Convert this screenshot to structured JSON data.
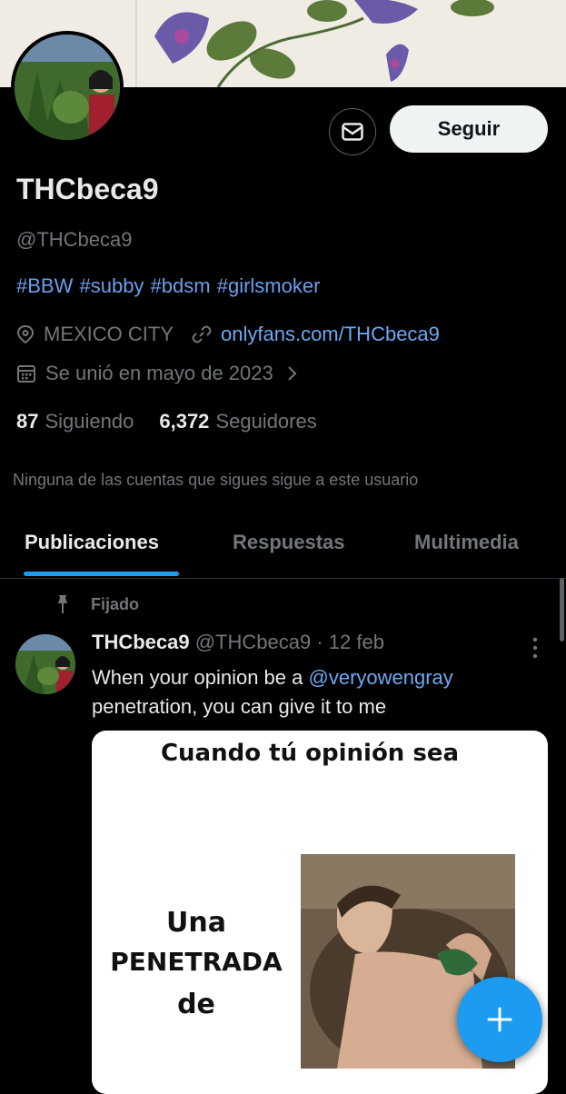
{
  "profile": {
    "name": "THCbeca9",
    "handle": "@THCbeca9",
    "bio_tags": [
      "#BBW",
      "#subby",
      "#bdsm",
      "#girlsmoker"
    ],
    "location": "MEXICO CITY",
    "website": "onlyfans.com/THCbeca9",
    "joined": "Se unió en mayo de 2023",
    "following_count": "87",
    "following_label": "Siguiendo",
    "followers_count": "6,372",
    "followers_label": "Seguidores",
    "no_mutual_text": "Ninguna de las cuentas que sigues sigue a este usuario"
  },
  "actions": {
    "follow_label": "Seguir"
  },
  "tabs": [
    {
      "label": "Publicaciones",
      "active": true
    },
    {
      "label": "Respuestas",
      "active": false
    },
    {
      "label": "Multimedia",
      "active": false
    }
  ],
  "post": {
    "pinned_label": "Fijado",
    "author_name": "THCbeca9",
    "author_handle": "@THCbeca9",
    "date": "· 12 feb",
    "text_before": "When your opinion be a ",
    "mention": "@veryowengray",
    "text_after": "penetration, you can give it to me",
    "media": {
      "top_text": "Cuando tú opinión sea",
      "left_lines": [
        "Una",
        "PENETRADA",
        "de"
      ]
    }
  },
  "colors": {
    "accent": "#1d9bf0",
    "background": "#000000",
    "secondary_text": "#71767b"
  },
  "icons": {
    "location": "map-pin-icon",
    "link": "link-icon",
    "calendar": "calendar-icon",
    "pin": "pin-icon",
    "mail": "mail-icon",
    "compose": "plus-icon"
  }
}
